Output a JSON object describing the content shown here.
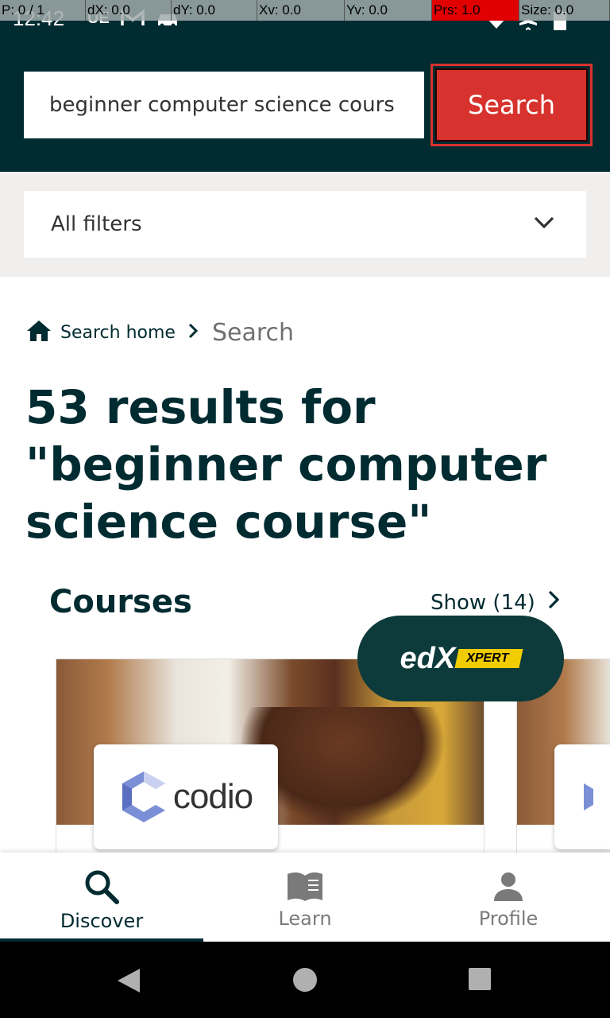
{
  "status_bar": {
    "time": "12:42",
    "debug": [
      "P: 0 / 1",
      "dX: 0.0",
      "dY: 0.0",
      "Xv: 0.0",
      "Yv: 0.0",
      "Prs: 1.0",
      "Size: 0.0"
    ],
    "icons": [
      "ue-icon",
      "gmail-icon",
      "car-icon",
      "wifi-icon",
      "airplane-icon",
      "battery-icon"
    ]
  },
  "search": {
    "value": "beginner computer science cours",
    "button_label": "Search"
  },
  "filters": {
    "label": "All filters"
  },
  "breadcrumb": {
    "home": "Search home",
    "current": "Search"
  },
  "results_title": "53 results for \"beginner computer science course\"",
  "courses": {
    "heading": "Courses",
    "show_label": "Show (14)",
    "cards": [
      {
        "partner": "codio"
      }
    ]
  },
  "xpert": {
    "brand": "edX",
    "tag": "XPERT"
  },
  "bottom_nav": {
    "items": [
      {
        "label": "Discover",
        "icon": "search-icon",
        "active": true
      },
      {
        "label": "Learn",
        "icon": "book-icon",
        "active": false
      },
      {
        "label": "Profile",
        "icon": "person-icon",
        "active": false
      }
    ]
  },
  "colors": {
    "brand_dark": "#002b31",
    "accent_red": "#d7322d",
    "xpert_yellow": "#f0cc00"
  }
}
